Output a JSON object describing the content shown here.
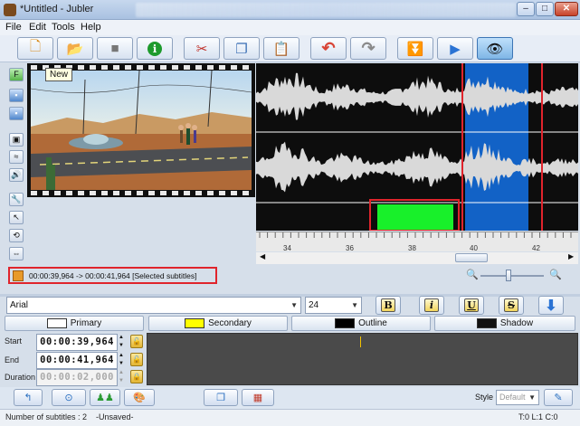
{
  "window": {
    "title": "*Untitled - Jubler",
    "minimize_label": "–",
    "maximize_label": "□",
    "close_label": "✕"
  },
  "menu": {
    "items": [
      {
        "label": "File"
      },
      {
        "label": "Edit"
      },
      {
        "label": "Tools"
      },
      {
        "label": "Help"
      }
    ]
  },
  "toolbar": {
    "buttons": [
      {
        "icon": "new-file-icon",
        "glyph": "🗋"
      },
      {
        "icon": "open-folder-icon",
        "glyph": "📂"
      },
      {
        "icon": "save-icon",
        "glyph": "■"
      },
      {
        "icon": "info-icon",
        "glyph": "ℹ"
      },
      {
        "icon": "cut-icon",
        "glyph": "✂"
      },
      {
        "icon": "copy-icon",
        "glyph": "❐"
      },
      {
        "icon": "paste-icon",
        "glyph": "📋"
      },
      {
        "icon": "undo-icon",
        "glyph": "↶"
      },
      {
        "icon": "redo-icon",
        "glyph": "↷"
      },
      {
        "icon": "collapse-icon",
        "glyph": "⏬"
      },
      {
        "icon": "play-icon",
        "glyph": "▶"
      },
      {
        "icon": "preview-eye-icon",
        "glyph": "👁"
      }
    ],
    "tooltip": "New"
  },
  "waveform": {
    "ruler_labels": [
      "34",
      "36",
      "38",
      "40",
      "42"
    ]
  },
  "selection_info": "00:00:39,964 -> 00:00:41,964 [Selected subtitles]",
  "font_row": {
    "font": "Arial",
    "size": "24",
    "bold": "B",
    "italic": "i",
    "underline": "U",
    "strike": "S"
  },
  "style_buttons": [
    {
      "label": "Primary",
      "color": "#ffffff"
    },
    {
      "label": "Secondary",
      "color": "#ffff00"
    },
    {
      "label": "Outline",
      "color": "#000000"
    },
    {
      "label": "Shadow",
      "color": "#111111"
    }
  ],
  "timing": {
    "start_label": "Start",
    "start_value": "00:00:39,964",
    "end_label": "End",
    "end_value": "00:00:41,964",
    "duration_label": "Duration",
    "duration_value": "00:00:02,000"
  },
  "bottom": {
    "style_label": "Style",
    "style_value": "Default"
  },
  "status": {
    "count": "Number of subtitles : 2",
    "saved": "-Unsaved-",
    "position": "T:0 L:1 C:0"
  },
  "colors": {
    "selection_blue": "#1262c6",
    "marker_green": "#18f02a",
    "highlight_red": "#e0242c"
  }
}
